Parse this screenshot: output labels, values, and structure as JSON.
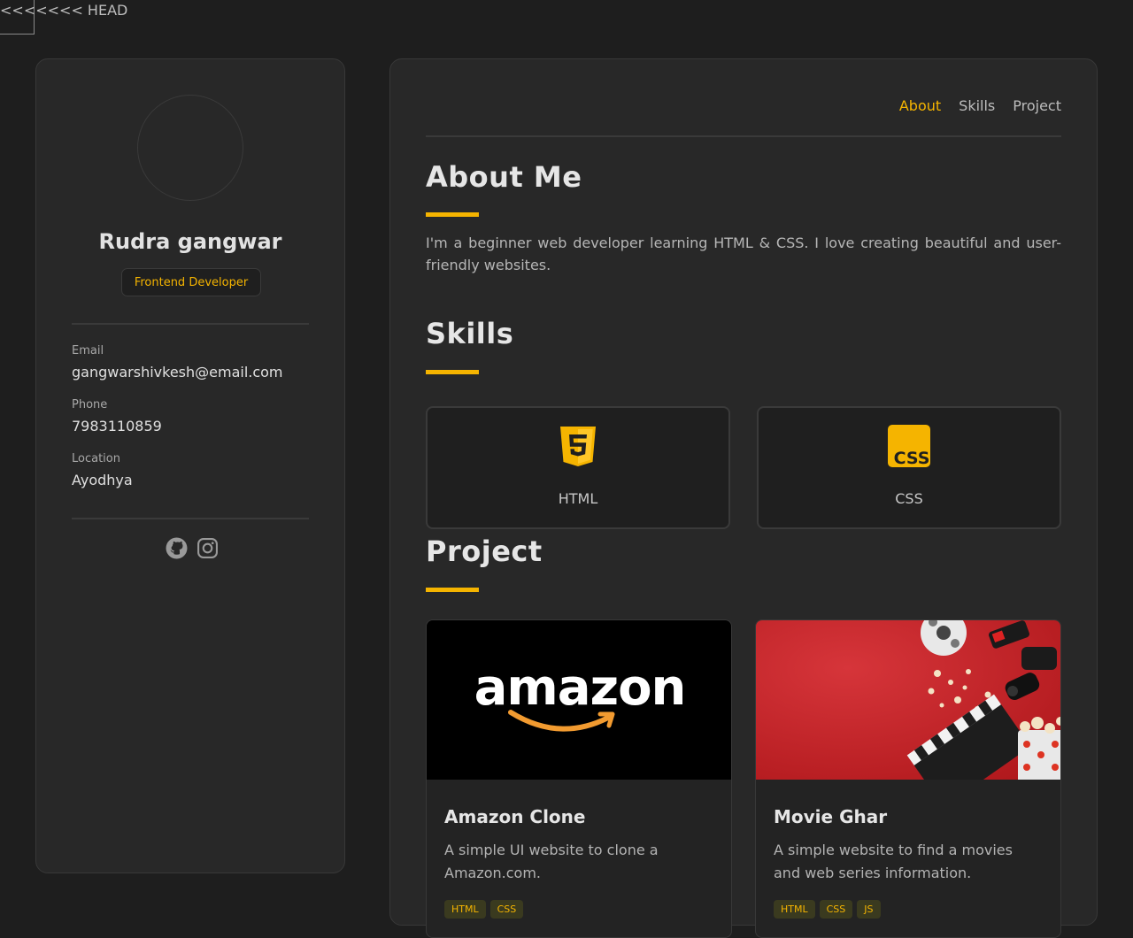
{
  "conflict_marker": "<<<<<<< HEAD",
  "sidebar": {
    "name": "Rudra gangwar",
    "role": "Frontend Developer",
    "info": [
      {
        "label": "Email",
        "value": "gangwarshivkesh@email.com"
      },
      {
        "label": "Phone",
        "value": "7983110859"
      },
      {
        "label": "Location",
        "value": "Ayodhya"
      }
    ],
    "socials": [
      "github-icon",
      "instagram-icon"
    ]
  },
  "nav": {
    "items": [
      "About",
      "Skills",
      "Project"
    ],
    "active": "About"
  },
  "about": {
    "title": "About Me",
    "text": "I'm a beginner web developer learning HTML & CSS. I love creating beautiful and user-friendly websites."
  },
  "skills": {
    "title": "Skills",
    "items": [
      {
        "label": "HTML",
        "icon": "html5-icon"
      },
      {
        "label": "CSS",
        "icon": "css-icon"
      }
    ]
  },
  "projects": {
    "title": "Project",
    "items": [
      {
        "title": "Amazon Clone",
        "description": "A simple UI website to clone a Amazon.com.",
        "logo_text": "amazon",
        "tags": [
          "HTML",
          "CSS"
        ]
      },
      {
        "title": "Movie Ghar",
        "description": "A simple website to find a movies and web series information.",
        "tags": [
          "HTML",
          "CSS",
          "JS"
        ]
      }
    ]
  },
  "colors": {
    "accent": "#f5b400",
    "background": "#1e1e1e",
    "card": "#282828"
  }
}
